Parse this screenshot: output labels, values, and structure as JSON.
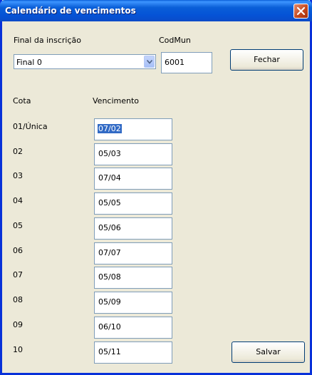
{
  "window": {
    "title": "Calendário de vencimentos"
  },
  "final_label": "Final da inscrição",
  "final_value": "Final 0",
  "codmun_label": "CodMun",
  "codmun_value": "6001",
  "btn_fechar": "Fechar",
  "btn_salvar": "Salvar",
  "col_cota": "Cota",
  "col_vencimento": "Vencimento",
  "rows": [
    {
      "cota": "01/Única",
      "venc": "07/02"
    },
    {
      "cota": "02",
      "venc": "05/03"
    },
    {
      "cota": "03",
      "venc": "07/04"
    },
    {
      "cota": "04",
      "venc": "05/05"
    },
    {
      "cota": "05",
      "venc": "05/06"
    },
    {
      "cota": "06",
      "venc": "07/07"
    },
    {
      "cota": "07",
      "venc": "05/08"
    },
    {
      "cota": "08",
      "venc": "05/09"
    },
    {
      "cota": "09",
      "venc": "06/10"
    },
    {
      "cota": "10",
      "venc": "05/11"
    }
  ],
  "icons": {
    "close": "close-icon",
    "dropdown": "chevron-down-icon"
  },
  "colors": {
    "titlebar": "#0a5fd8",
    "window_bg": "#ece9d8",
    "selection": "#316ac5"
  }
}
